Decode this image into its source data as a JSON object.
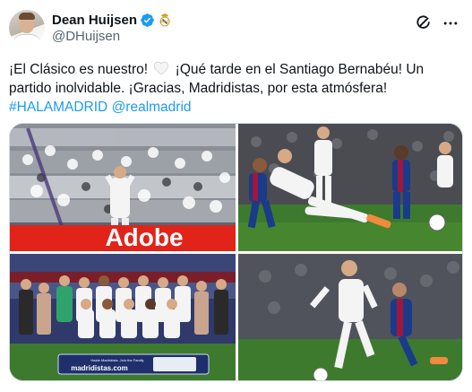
{
  "author": {
    "display_name": "Dean Huijsen",
    "handle": "@DHuijsen"
  },
  "tweet": {
    "text_part1": "¡El Clásico es nuestro! ",
    "text_part2": " ¡Qué tarde en el Santiago Bernabéu! Un partido inolvidable. ¡Gracias, Madridistas, por esta atmósfera!",
    "hashtag": "#HALAMADRID",
    "mention": "@realmadrid"
  },
  "media": {
    "banner_text": "Adobe",
    "sponsor_board_line1": "Hazte Madridista. Join the Family",
    "sponsor_board_line2": "madridistas.com"
  },
  "colors": {
    "link": "#1d9bf0",
    "verified": "#1d9bf0",
    "secondary_text": "#536471",
    "pitch": "#3d7a2e",
    "adobe_red": "#e2231a",
    "barca_blue": "#1a3a8a",
    "barca_red": "#a3163b"
  },
  "icons": [
    "verified-badge-icon",
    "real-madrid-crest-icon",
    "grok-icon",
    "more-options-icon",
    "white-heart-icon"
  ]
}
